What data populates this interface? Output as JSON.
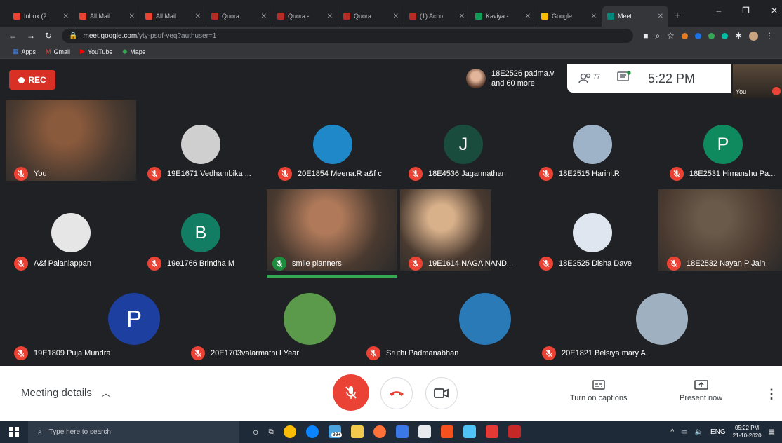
{
  "browser": {
    "tabs": [
      {
        "label": "Inbox (2",
        "color": "#ea4335"
      },
      {
        "label": "All Mail",
        "color": "#ea4335"
      },
      {
        "label": "All Mail",
        "color": "#ea4335"
      },
      {
        "label": "Quora",
        "color": "#b92b27"
      },
      {
        "label": "Quora -",
        "color": "#b92b27"
      },
      {
        "label": "Quora",
        "color": "#b92b27"
      },
      {
        "label": "(1) Acco",
        "color": "#b92b27"
      },
      {
        "label": "Kaviya -",
        "color": "#0f9d58"
      },
      {
        "label": "Google",
        "color": "#fbbc04"
      },
      {
        "label": "Meet",
        "color": "#00897b",
        "active": true
      }
    ],
    "url_host": "meet.google.com",
    "url_path": "/yty-psuf-veq?authuser=1",
    "bookmarks": [
      "Apps",
      "Gmail",
      "YouTube",
      "Maps"
    ]
  },
  "meet": {
    "rec_label": "REC",
    "people_preview": {
      "name": "18E2526 padma.v",
      "more": "and 60 more"
    },
    "participant_count": "77",
    "time": "5:22 PM",
    "self_label": "You",
    "participants": [
      {
        "name": "You",
        "initial": "",
        "color": "#8a5a3c"
      },
      {
        "name": "19E1671 Vedhambika ...",
        "initial": "",
        "color": "#cfcfcf"
      },
      {
        "name": "20E1854 Meena.R a&f c",
        "initial": "",
        "color": "#1e88c8"
      },
      {
        "name": "18E4536 Jagannathan",
        "initial": "J",
        "color": "#1a4c3e"
      },
      {
        "name": "18E2515 Harini.R",
        "initial": "",
        "color": "#9fb3c8"
      },
      {
        "name": "18E2531 Himanshu Pa...",
        "initial": "P",
        "color": "#0f8a5f"
      },
      {
        "name": "A&f Palaniappan",
        "initial": "",
        "color": "#e6e6e6"
      },
      {
        "name": "19e1766 Brindha M",
        "initial": "B",
        "color": "#127d63"
      },
      {
        "name": "smile planners",
        "initial": "",
        "color": "#b07a5a"
      },
      {
        "name": "19E1614 NAGA NAND...",
        "initial": "",
        "color": "#d8b08a"
      },
      {
        "name": "18E2525 Disha Dave",
        "initial": "",
        "color": "#dfe6ef"
      },
      {
        "name": "18E2532 Nayan P Jain",
        "initial": "",
        "color": "#6a5a4a"
      },
      {
        "name": "19E1809 Puja Mundra",
        "initial": "P",
        "color": "#1d3fa0"
      },
      {
        "name": "20E1703valarmathi I Year",
        "initial": "",
        "color": "#5a9a4a"
      },
      {
        "name": "Sruthi Padmanabhan",
        "initial": "",
        "color": "#2a7ab8"
      },
      {
        "name": "20E1821 Belsiya mary A.",
        "initial": "",
        "color": "#9fb0c0"
      }
    ]
  },
  "controls": {
    "meeting_details": "Meeting details",
    "captions": "Turn on captions",
    "present": "Present now"
  },
  "taskbar": {
    "search_placeholder": "Type here to search",
    "badge": "99+",
    "lang": "ENG",
    "time": "05:22 PM",
    "date": "21-10-2020"
  }
}
